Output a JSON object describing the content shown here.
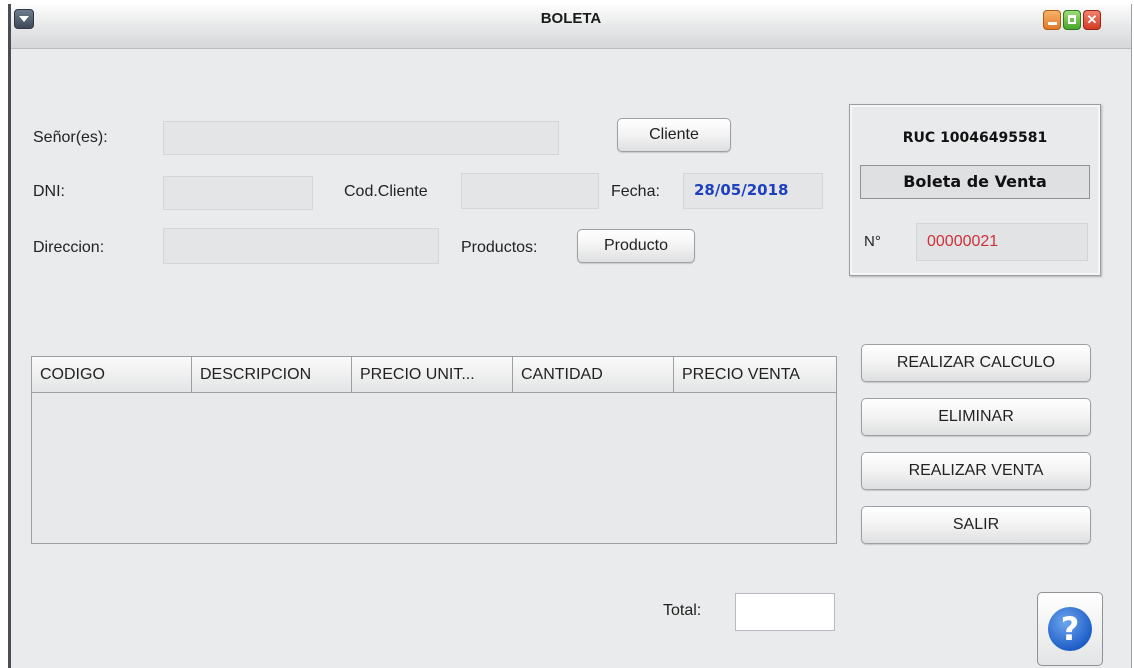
{
  "window": {
    "title": "BOLETA",
    "menu_icon": "chevron-down-icon",
    "controls": [
      "minimize-icon",
      "maximize-icon",
      "close-icon"
    ]
  },
  "form": {
    "senor_label": "Señor(es):",
    "senor_value": "",
    "cliente_button": "Cliente",
    "dni_label": "DNI:",
    "dni_value": "",
    "cod_cliente_label": "Cod.Cliente",
    "cod_cliente_value": "",
    "fecha_label": "Fecha:",
    "fecha_value": "28/05/2018",
    "direccion_label": "Direccion:",
    "direccion_value": "",
    "productos_label": "Productos:",
    "producto_button": "Producto"
  },
  "receipt": {
    "ruc": "RUC 10046495581",
    "doc_type": "Boleta de Venta",
    "number_label": "N°",
    "number_value": "00000021"
  },
  "table": {
    "columns": [
      "CODIGO",
      "DESCRIPCION",
      "PRECIO UNIT...",
      "CANTIDAD",
      "PRECIO VENTA"
    ],
    "rows": []
  },
  "actions": {
    "calcular": "REALIZAR CALCULO",
    "eliminar": "ELIMINAR",
    "venta": "REALIZAR VENTA",
    "salir": "SALIR"
  },
  "total": {
    "label": "Total:",
    "value": ""
  },
  "help": {
    "icon": "help-icon",
    "glyph": "?"
  },
  "colors": {
    "date_text": "#1e3fbf",
    "number_text": "#d0303a",
    "window_bg": "#eaebec"
  }
}
